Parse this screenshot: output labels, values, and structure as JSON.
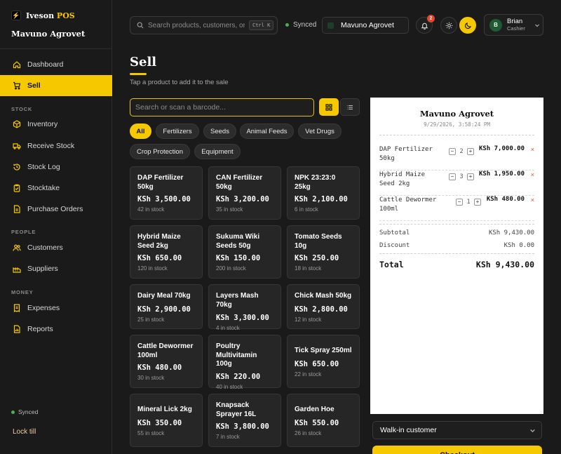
{
  "brand": {
    "name_prefix": "Iveson",
    "name_suffix": "POS",
    "logo_glyph": "⚡",
    "store": "Mavuno Agrovet"
  },
  "sidebar": {
    "dashboard": "Dashboard",
    "sell": "Sell",
    "stock_label": "STOCK",
    "inventory": "Inventory",
    "receive_stock": "Receive Stock",
    "stock_log": "Stock Log",
    "stocktake": "Stocktake",
    "purchase_orders": "Purchase Orders",
    "people_label": "PEOPLE",
    "customers": "Customers",
    "suppliers": "Suppliers",
    "money_label": "MONEY",
    "expenses": "Expenses",
    "reports": "Reports",
    "synced": "Synced",
    "lock": "Lock till"
  },
  "topbar": {
    "search_placeholder": "Search products, customers, orders",
    "shortcut": "Ctrl K",
    "synced": "Synced",
    "store_select": "Mavuno Agrovet",
    "notifications": "2",
    "user": {
      "initial": "B",
      "name": "Brian",
      "role": "Cashier"
    }
  },
  "page": {
    "title": "Sell",
    "subtitle": "Tap a product to add it to the sale",
    "barcode_placeholder": "Search or scan a barcode..."
  },
  "filters": [
    "All",
    "Fertilizers",
    "Seeds",
    "Animal Feeds",
    "Vet Drugs",
    "Crop Protection",
    "Equipment"
  ],
  "products": [
    {
      "name": "DAP Fertilizer 50kg",
      "price": "KSh 3,500.00",
      "stock": "42 in stock"
    },
    {
      "name": "CAN Fertilizer 50kg",
      "price": "KSh 3,200.00",
      "stock": "35 in stock"
    },
    {
      "name": "NPK 23:23:0 25kg",
      "price": "KSh 2,100.00",
      "stock": "6 in stock"
    },
    {
      "name": "Hybrid Maize Seed 2kg",
      "price": "KSh 650.00",
      "stock": "120 in stock"
    },
    {
      "name": "Sukuma Wiki Seeds 50g",
      "price": "KSh 150.00",
      "stock": "200 in stock"
    },
    {
      "name": "Tomato Seeds 10g",
      "price": "KSh 250.00",
      "stock": "18 in stock"
    },
    {
      "name": "Dairy Meal 70kg",
      "price": "KSh 2,900.00",
      "stock": "25 in stock"
    },
    {
      "name": "Layers Mash 70kg",
      "price": "KSh 3,300.00",
      "stock": "4 in stock"
    },
    {
      "name": "Chick Mash 50kg",
      "price": "KSh 2,800.00",
      "stock": "12 in stock"
    },
    {
      "name": "Cattle Dewormer 100ml",
      "price": "KSh 480.00",
      "stock": "30 in stock"
    },
    {
      "name": "Poultry Multivitamin 100g",
      "price": "KSh 220.00",
      "stock": "40 in stock"
    },
    {
      "name": "Tick Spray 250ml",
      "price": "KSh 650.00",
      "stock": "22 in stock"
    },
    {
      "name": "Mineral Lick 2kg",
      "price": "KSh 350.00",
      "stock": "55 in stock"
    },
    {
      "name": "Knapsack Sprayer 16L",
      "price": "KSh 3,800.00",
      "stock": "7 in stock"
    },
    {
      "name": "Garden Hoe",
      "price": "KSh 550.00",
      "stock": "26 in stock"
    }
  ],
  "receipt": {
    "store": "Mavuno Agrovet",
    "datetime": "9/29/2026, 3:58:24 PM",
    "lines": [
      {
        "name": "DAP Fertilizer 50kg",
        "qty": "2",
        "price": "KSh 7,000.00"
      },
      {
        "name": "Hybrid Maize Seed 2kg",
        "qty": "3",
        "price": "KSh 1,950.00"
      },
      {
        "name": "Cattle Dewormer 100ml",
        "qty": "1",
        "price": "KSh 480.00"
      }
    ],
    "subtotal_label": "Subtotal",
    "subtotal": "KSh 9,430.00",
    "discount_label": "Discount",
    "discount": "KSh 0.00",
    "total_label": "Total",
    "total": "KSh 9,430.00",
    "customer": "Walk-in customer",
    "checkout": "Checkout"
  },
  "colors": {
    "accent": "#f5c800",
    "background": "#1a1a1a",
    "card": "#262626",
    "remove": "#d64a3a"
  },
  "icons": {
    "qty_minus": "−",
    "qty_plus": "+",
    "remove": "×"
  }
}
